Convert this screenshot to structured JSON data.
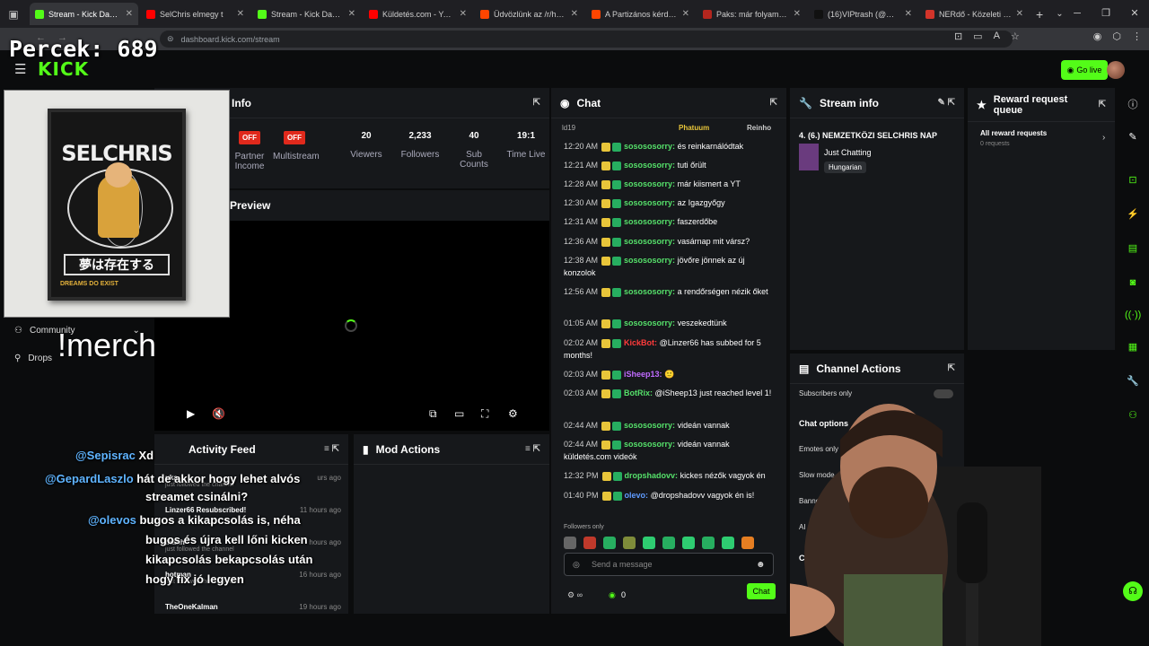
{
  "browser": {
    "tabs": [
      {
        "label": "Stream - Kick Dashboa",
        "color": "#53fc18",
        "active": true
      },
      {
        "label": "SelChris elmegy t",
        "color": "#ff0000"
      },
      {
        "label": "Stream - Kick Dashboa",
        "color": "#53fc18"
      },
      {
        "label": "Küldetés.com - YouTub",
        "color": "#ff0000"
      },
      {
        "label": "Üdvözlünk az /r/hunga",
        "color": "#ff4500"
      },
      {
        "label": "A Partizános kérdések",
        "color": "#ff4500"
      },
      {
        "label": "Paks: már folyamatos a",
        "color": "#b3261e"
      },
      {
        "label": "(16)VIPtrash (@mulatin",
        "color": "#111111"
      },
      {
        "label": "NERdő - Közeleti anim",
        "color": "#d2342a"
      }
    ],
    "url": "dashboard.kick.com/stream"
  },
  "overlay": {
    "percek": "Percek: 689",
    "merch": "!merch",
    "chat": [
      {
        "user": "@Sepisrac",
        "text": "Xd"
      },
      {
        "user": "@GepardLaszlo",
        "text": "hát de akkor hogy lehet alvós"
      },
      {
        "user": "",
        "text": "streamet csinálni?"
      },
      {
        "user": "@olevos",
        "text": "bugos a kikapcsolás is, néha"
      },
      {
        "user": "",
        "text": "bugos és újra kell lőni kicken"
      },
      {
        "user": "",
        "text": "kikapcsolás bekapcsolás után"
      },
      {
        "user": "",
        "text": "hogy fix jó legyen"
      }
    ],
    "poster_title": "SELCHRIS",
    "poster_jp": "夢は存在する",
    "poster_sub": "DREAMS DO EXIST"
  },
  "header": {
    "logo": "KICK",
    "go_live": "Go live"
  },
  "nav": {
    "community": "Community",
    "drops": "Drops"
  },
  "session": {
    "title": "Info",
    "stats": [
      {
        "value": "OFF",
        "label": "Partner Income",
        "off": true
      },
      {
        "value": "OFF",
        "label": "Multistream",
        "off": true
      },
      {
        "value": "20",
        "label": "Viewers"
      },
      {
        "value": "2,233",
        "label": "Followers"
      },
      {
        "value": "40",
        "label": "Sub Counts"
      },
      {
        "value": "19:1",
        "label": "Time Live"
      }
    ]
  },
  "preview": {
    "title": "Preview"
  },
  "activity": {
    "title": "Activity Feed",
    "items": [
      {
        "name": "uka",
        "sub": "just followed the channel",
        "time": "urs ago"
      },
      {
        "name": "Linzer66 Resubscribed!",
        "sub": "",
        "time": "11 hours ago"
      },
      {
        "name": "thanh",
        "sub": "just followed the channel",
        "time": "hours ago"
      },
      {
        "name": "hotman",
        "sub": "just followed the channel",
        "time": "16 hours ago"
      },
      {
        "name": "TheOneKalman",
        "sub": "",
        "time": "19 hours ago"
      }
    ]
  },
  "mod_actions": {
    "title": "Mod Actions"
  },
  "chat": {
    "title": "Chat",
    "pinned": [
      "ld19",
      "Phatuum",
      "Reinho"
    ],
    "messages": [
      {
        "time": "12:20 AM",
        "user": "sosososorry:",
        "text": "és reinkarnálódtak"
      },
      {
        "time": "12:21 AM",
        "user": "sosososorry:",
        "text": "tuti őrült"
      },
      {
        "time": "12:28 AM",
        "user": "sosososorry:",
        "text": "már kiismert a YT"
      },
      {
        "time": "12:30 AM",
        "user": "sosososorry:",
        "text": "az Igazgyőgy"
      },
      {
        "time": "12:31 AM",
        "user": "sosososorry:",
        "text": "faszerdőbe"
      },
      {
        "time": "12:36 AM",
        "user": "sosososorry:",
        "text": "vasárnap mit vársz?"
      },
      {
        "time": "12:38 AM",
        "user": "sosososorry:",
        "text": "jövőre jönnek az új konzolok"
      },
      {
        "time": "12:56 AM",
        "user": "sosososorry:",
        "text": "a rendőrségen nézik őket"
      },
      {
        "time": "01:05 AM",
        "user": "sosososorry:",
        "text": "veszekedtünk"
      },
      {
        "time": "02:02 AM",
        "user": "KickBot:",
        "text": "@Linzer66 has subbed for 5 months!",
        "color": "#ff3b3b"
      },
      {
        "time": "02:03 AM",
        "user": "iSheep13:",
        "text": "🙂",
        "color": "#c06bff"
      },
      {
        "time": "02:03 AM",
        "user": "BotRix:",
        "text": "@iSheep13 just reached level 1!",
        "color": "#55e06a"
      },
      {
        "time": "02:44 AM",
        "user": "sosososorry:",
        "text": "videán vannak"
      },
      {
        "time": "02:44 AM",
        "user": "sosososorry:",
        "text": "videán vannak küldetés.com videók"
      },
      {
        "time": "12:32 PM",
        "user": "dropshadovv:",
        "text": "kickes nézők vagyok én"
      },
      {
        "time": "01:40 PM",
        "user": "olevo:",
        "text": "@dropshadovv vagyok én is!",
        "color": "#5f9bff"
      }
    ],
    "followers_only": "Followers only",
    "placeholder": "Send a message",
    "count": "0",
    "send": "Chat"
  },
  "stream_info": {
    "title": "Stream info",
    "stream_title": "4. (6.) NEMZETKÖZI SELCHRIS NAP",
    "category": "Just Chatting",
    "tag": "Hungarian"
  },
  "rewards": {
    "title": "Reward request queue",
    "all": "All reward requests",
    "count": "0 requests"
  },
  "channel_actions": {
    "title": "Channel Actions",
    "subs_only": "Subscribers only",
    "chat_options": "Chat options",
    "emotes_only": "Emotes only",
    "slow_mode": "Slow mode",
    "banned": "Banne",
    "ai": "AI Cha",
    "ch": "Ch"
  },
  "colors": {
    "accent": "#53fc18",
    "off": "#e0291c"
  }
}
